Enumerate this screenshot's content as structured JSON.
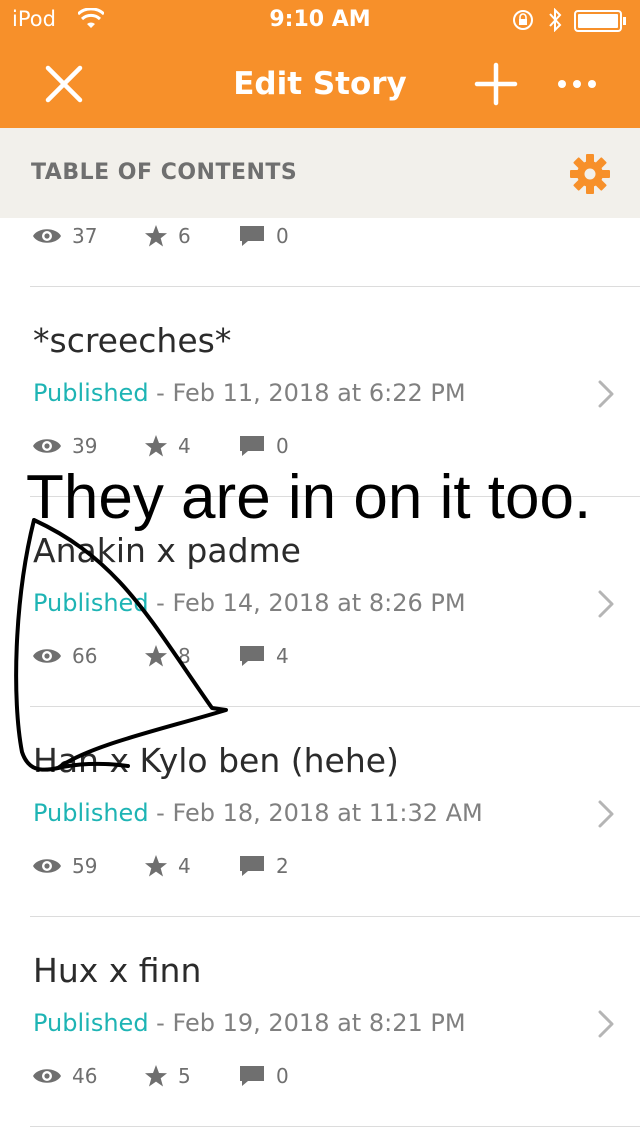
{
  "status_bar": {
    "carrier": "iPod",
    "time": "9:10 AM",
    "icons": [
      "wifi-icon",
      "orientation-lock-icon",
      "bluetooth-icon",
      "battery-icon"
    ]
  },
  "nav": {
    "title": "Edit Story",
    "icons": [
      "close-icon",
      "plus-icon",
      "more-icon"
    ]
  },
  "toc": {
    "label": "TABLE OF CONTENTS",
    "icon": "gear-icon"
  },
  "top_stats": {
    "views": "37",
    "votes": "6",
    "comments": "0"
  },
  "parts": [
    {
      "title": "*screeches*",
      "status": "Published",
      "date": " - Feb 11, 2018 at 6:22 PM",
      "views": "39",
      "votes": "4",
      "comments": "0"
    },
    {
      "title": "Anakin x padme",
      "status": "Published",
      "date": " - Feb 14, 2018 at 8:26 PM",
      "views": "66",
      "votes": "8",
      "comments": "4"
    },
    {
      "title": "Han x Kylo ben (hehe)",
      "status": "Published",
      "date": " - Feb 18, 2018 at 11:32 AM",
      "views": "59",
      "votes": "4",
      "comments": "2"
    },
    {
      "title": "Hux x finn",
      "status": "Published",
      "date": " - Feb 19, 2018 at 8:21 PM",
      "views": "46",
      "votes": "5",
      "comments": "0"
    }
  ],
  "overlay": {
    "caption": "They are in on it too."
  },
  "colors": {
    "nav_bg": "#f7902a",
    "published": "#1eb4b4",
    "toc_bg": "#f2f0eb",
    "meta_gray": "#808080"
  }
}
